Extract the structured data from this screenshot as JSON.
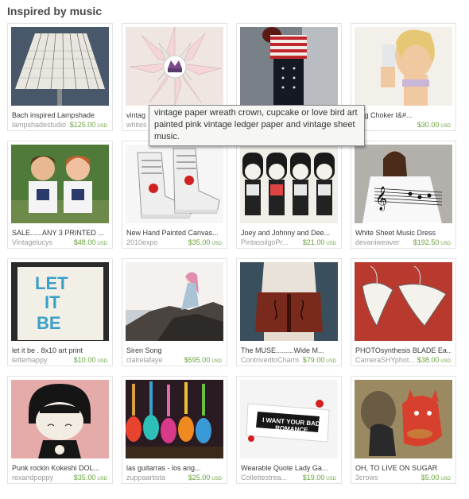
{
  "header": {
    "title": "Inspired by music"
  },
  "currency": "USD",
  "tooltip": {
    "text": "vintage paper wreath crown, cupcake or love bird art painted pink vintage ledger paper and vintage sheet music."
  },
  "items": [
    {
      "title": "Bach inspired Lampshade",
      "shop": "lampshadestudio",
      "price": "$125.00"
    },
    {
      "title": "vintag",
      "shop": "whites",
      "price": ""
    },
    {
      "title": "",
      "shop": "",
      "price": ""
    },
    {
      "title": "zing Choker I&#...",
      "shop": "",
      "price": "$30.00"
    },
    {
      "title": "SALE......ANY 3 PRINTED ...",
      "shop": "Vintagelucys",
      "price": "$48.00"
    },
    {
      "title": "New Hand Painted Canvas...",
      "shop": "2010expo",
      "price": "$35.00"
    },
    {
      "title": "Joey and Johnny and Dee...",
      "shop": "PintassilgoPr...",
      "price": "$21.00"
    },
    {
      "title": "White Sheet Music Dress",
      "shop": "devaniweaver",
      "price": "$192.50"
    },
    {
      "title": "let it be . 8x10 art print",
      "shop": "letterhappy",
      "price": "$10.00"
    },
    {
      "title": "Siren Song",
      "shop": "clairelafaye",
      "price": "$595.00"
    },
    {
      "title": "The MUSE.........Wide M...",
      "shop": "ContrivedtoCharm",
      "price": "$79.00"
    },
    {
      "title": "PHOTOsynthesis BLADE Ea...",
      "shop": "CameraSHYphot...",
      "price": "$38.00"
    },
    {
      "title": "Punk rockin Kokeshi DOL...",
      "shop": "rexandpoppy",
      "price": "$35.00"
    },
    {
      "title": "las guitarras - los ang...",
      "shop": "zuppaartista",
      "price": "$25.00"
    },
    {
      "title": "Wearable Quote Lady Ga...",
      "shop": "Collettestrea...",
      "price": "$19.00"
    },
    {
      "title": "OH, TO LIVE ON SUGAR",
      "shop": "3crows",
      "price": "$5.00"
    }
  ],
  "image_text": {
    "let_it_be": [
      "LET",
      "IT",
      "BE"
    ],
    "quote": [
      "I WANT YOUR BAD",
      "ROMANCE"
    ]
  }
}
